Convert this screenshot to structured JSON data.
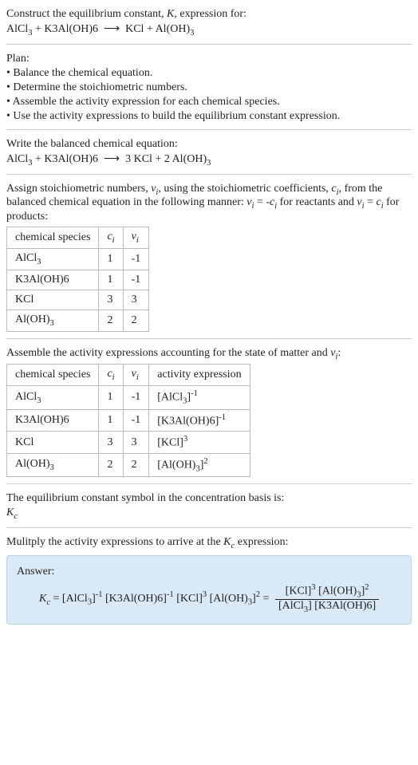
{
  "title_line1": "Construct the equilibrium constant, K, expression for:",
  "title_eq": "AlCl₃ + K3Al(OH)6 ⟶ KCl + Al(OH)₃",
  "plan_heading": "Plan:",
  "plan_items": [
    "• Balance the chemical equation.",
    "• Determine the stoichiometric numbers.",
    "• Assemble the activity expression for each chemical species.",
    "• Use the activity expressions to build the equilibrium constant expression."
  ],
  "balanced_heading": "Write the balanced chemical equation:",
  "balanced_eq": "AlCl₃ + K3Al(OH)6 ⟶ 3 KCl + 2 Al(OH)₃",
  "stoich_intro_a": "Assign stoichiometric numbers, νᵢ, using the stoichiometric coefficients, cᵢ, from the balanced chemical equation in the following manner: νᵢ = -cᵢ for reactants and νᵢ = cᵢ for products:",
  "stoich_table": {
    "headers": [
      "chemical species",
      "cᵢ",
      "νᵢ"
    ],
    "rows": [
      [
        "AlCl₃",
        "1",
        "-1"
      ],
      [
        "K3Al(OH)6",
        "1",
        "-1"
      ],
      [
        "KCl",
        "3",
        "3"
      ],
      [
        "Al(OH)₃",
        "2",
        "2"
      ]
    ]
  },
  "activity_intro": "Assemble the activity expressions accounting for the state of matter and νᵢ:",
  "activity_table": {
    "headers": [
      "chemical species",
      "cᵢ",
      "νᵢ",
      "activity expression"
    ],
    "rows": [
      [
        "AlCl₃",
        "1",
        "-1",
        "[AlCl₃]⁻¹"
      ],
      [
        "K3Al(OH)6",
        "1",
        "-1",
        "[K3Al(OH)6]⁻¹"
      ],
      [
        "KCl",
        "3",
        "3",
        "[KCl]³"
      ],
      [
        "Al(OH)₃",
        "2",
        "2",
        "[Al(OH)₃]²"
      ]
    ]
  },
  "symbol_line1": "The equilibrium constant symbol in the concentration basis is:",
  "symbol_line2": "K_c",
  "multiply_intro": "Mulitply the activity expressions to arrive at the K_c expression:",
  "answer_label": "Answer:",
  "answer_lhs": "K_c = [AlCl₃]⁻¹ [K3Al(OH)6]⁻¹ [KCl]³ [Al(OH)₃]² =",
  "answer_num": "[KCl]³ [Al(OH)₃]²",
  "answer_den": "[AlCl₃] [K3Al(OH)6]"
}
